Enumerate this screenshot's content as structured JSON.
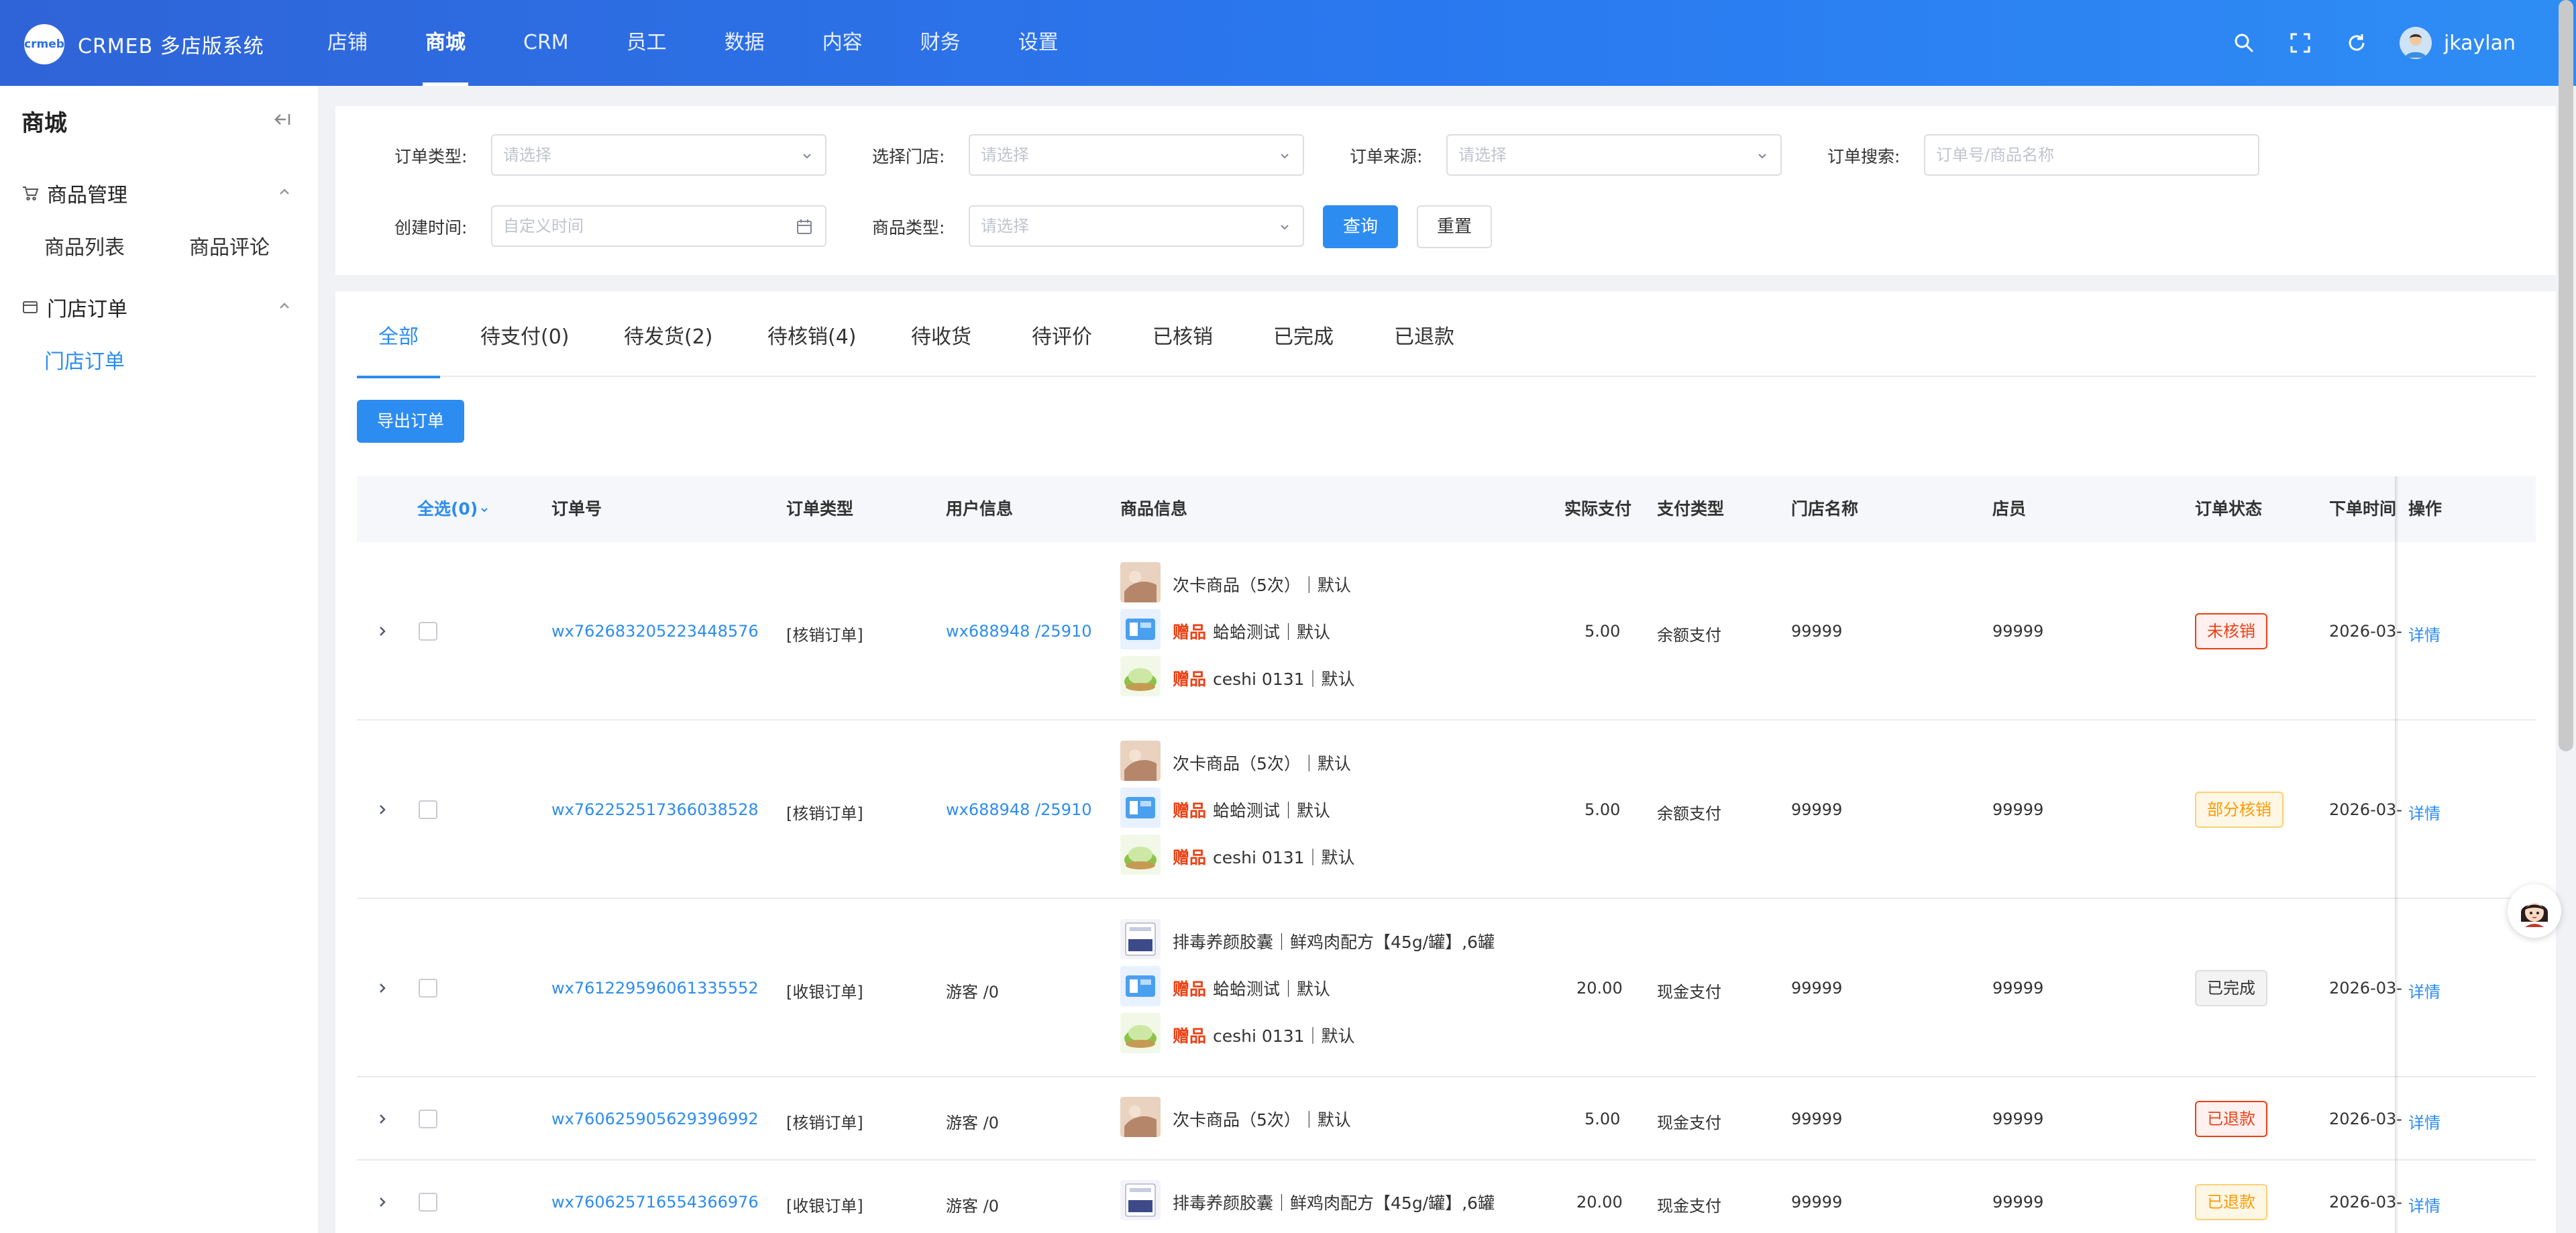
{
  "header": {
    "logo_text": "crmeb",
    "brand": "CRMEB 多店版系统",
    "nav": [
      "店铺",
      "商城",
      "CRM",
      "员工",
      "数据",
      "内容",
      "财务",
      "设置"
    ],
    "active_nav": "商城",
    "user_name": "jkaylan",
    "icons": [
      "search-icon",
      "fullscreen-icon",
      "refresh-icon"
    ]
  },
  "sidebar": {
    "title": "商城",
    "groups": [
      {
        "label": "商品管理",
        "icon": "cart-icon",
        "items": [
          "商品列表",
          "商品评论"
        ]
      },
      {
        "label": "门店订单",
        "icon": "window-icon",
        "items": [
          "门店订单"
        ]
      }
    ],
    "active_item": "门店订单"
  },
  "filters": {
    "order_type_label": "订单类型:",
    "order_type_placeholder": "请选择",
    "store_label": "选择门店:",
    "store_placeholder": "请选择",
    "source_label": "订单来源:",
    "source_placeholder": "请选择",
    "search_label": "订单搜索:",
    "search_placeholder": "订单号/商品名称",
    "time_label": "创建时间:",
    "time_placeholder": "自定义时间",
    "goods_type_label": "商品类型:",
    "goods_type_placeholder": "请选择",
    "query_button": "查询",
    "reset_button": "重置"
  },
  "tabs": [
    "全部",
    "待支付(0)",
    "待发货(2)",
    "待核销(4)",
    "待收货",
    "待评价",
    "已核销",
    "已完成",
    "已退款"
  ],
  "active_tab": "全部",
  "export_button": "导出订单",
  "table": {
    "select_all": "全选(0)",
    "columns": [
      "订单号",
      "订单类型",
      "用户信息",
      "商品信息",
      "实际支付",
      "支付类型",
      "门店名称",
      "店员",
      "订单状态",
      "下单时间",
      "操作"
    ],
    "rows": [
      {
        "order_no": "wx762683205223448576",
        "order_type": "[核销订单]",
        "user": "wx688948 /25910",
        "user_link": true,
        "goods": [
          {
            "gift": "",
            "name": "次卡商品（5次）｜默认",
            "thumb": "card"
          },
          {
            "gift": "赠品",
            "name": "蛤蛤测试｜默认",
            "thumb": "blue"
          },
          {
            "gift": "赠品",
            "name": "ceshi 0131｜默认",
            "thumb": "green"
          }
        ],
        "paid": "5.00",
        "pay_type": "余额支付",
        "store": "99999",
        "clerk": "99999",
        "status": "未核销",
        "status_style": "red",
        "time": "2026-03-",
        "action": "详情"
      },
      {
        "order_no": "wx762252517366038528",
        "order_type": "[核销订单]",
        "user": "wx688948 /25910",
        "user_link": true,
        "goods": [
          {
            "gift": "",
            "name": "次卡商品（5次）｜默认",
            "thumb": "card"
          },
          {
            "gift": "赠品",
            "name": "蛤蛤测试｜默认",
            "thumb": "blue"
          },
          {
            "gift": "赠品",
            "name": "ceshi 0131｜默认",
            "thumb": "green"
          }
        ],
        "paid": "5.00",
        "pay_type": "余额支付",
        "store": "99999",
        "clerk": "99999",
        "status": "部分核销",
        "status_style": "orange",
        "time": "2026-03-",
        "action": "详情"
      },
      {
        "order_no": "wx761229596061335552",
        "order_type": "[收银订单]",
        "user": "游客 /0",
        "user_link": false,
        "goods": [
          {
            "gift": "",
            "name": "排毒养颜胶囊｜鲜鸡肉配方【45g/罐】,6罐",
            "thumb": "box"
          },
          {
            "gift": "赠品",
            "name": "蛤蛤测试｜默认",
            "thumb": "blue"
          },
          {
            "gift": "赠品",
            "name": "ceshi 0131｜默认",
            "thumb": "green"
          }
        ],
        "paid": "20.00",
        "pay_type": "现金支付",
        "store": "99999",
        "clerk": "99999",
        "status": "已完成",
        "status_style": "gray",
        "time": "2026-03-",
        "action": "详情"
      },
      {
        "order_no": "wx760625905629396992",
        "order_type": "[核销订单]",
        "user": "游客 /0",
        "user_link": false,
        "goods": [
          {
            "gift": "",
            "name": "次卡商品（5次）｜默认",
            "thumb": "card"
          }
        ],
        "paid": "5.00",
        "pay_type": "现金支付",
        "store": "99999",
        "clerk": "99999",
        "status": "已退款",
        "status_style": "red",
        "time": "2026-03-",
        "action": "详情"
      },
      {
        "order_no": "wx760625716554366976",
        "order_type": "[收银订单]",
        "user": "游客 /0",
        "user_link": false,
        "goods": [
          {
            "gift": "",
            "name": "排毒养颜胶囊｜鲜鸡肉配方【45g/罐】,6罐",
            "thumb": "box"
          }
        ],
        "paid": "20.00",
        "pay_type": "现金支付",
        "store": "99999",
        "clerk": "99999",
        "status": "已退款",
        "status_style": "orange",
        "time": "2026-03-",
        "action": "详情"
      }
    ]
  },
  "colors": {
    "primary": "#2d8cf0",
    "header_start": "#2f64d8",
    "header_end": "#2e8df5",
    "danger": "#ed4014",
    "warning": "#ff9900"
  }
}
